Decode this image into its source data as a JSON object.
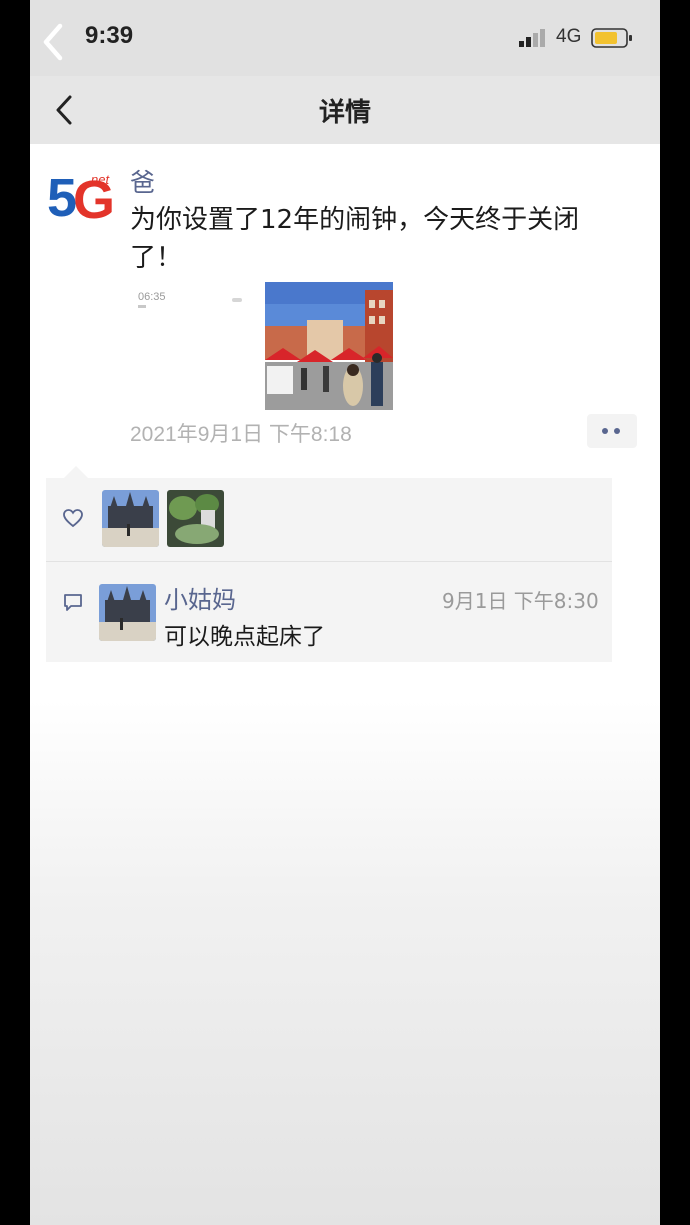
{
  "status_bar": {
    "time": "9:39",
    "network": "4G"
  },
  "nav": {
    "title": "详情"
  },
  "post": {
    "author": "爸",
    "text": "为你设置了12年的闹钟，今天终于关闭了！",
    "alarm_time": "06:35",
    "date": "2021年9月1日 下午8:18"
  },
  "likes": {
    "count": 2
  },
  "comments": [
    {
      "name": "小姑妈",
      "time": "9月1日 下午8:30",
      "text": "可以晚点起床了"
    }
  ],
  "colors": {
    "link_name": "#59668f",
    "battery": "#f2c230"
  }
}
